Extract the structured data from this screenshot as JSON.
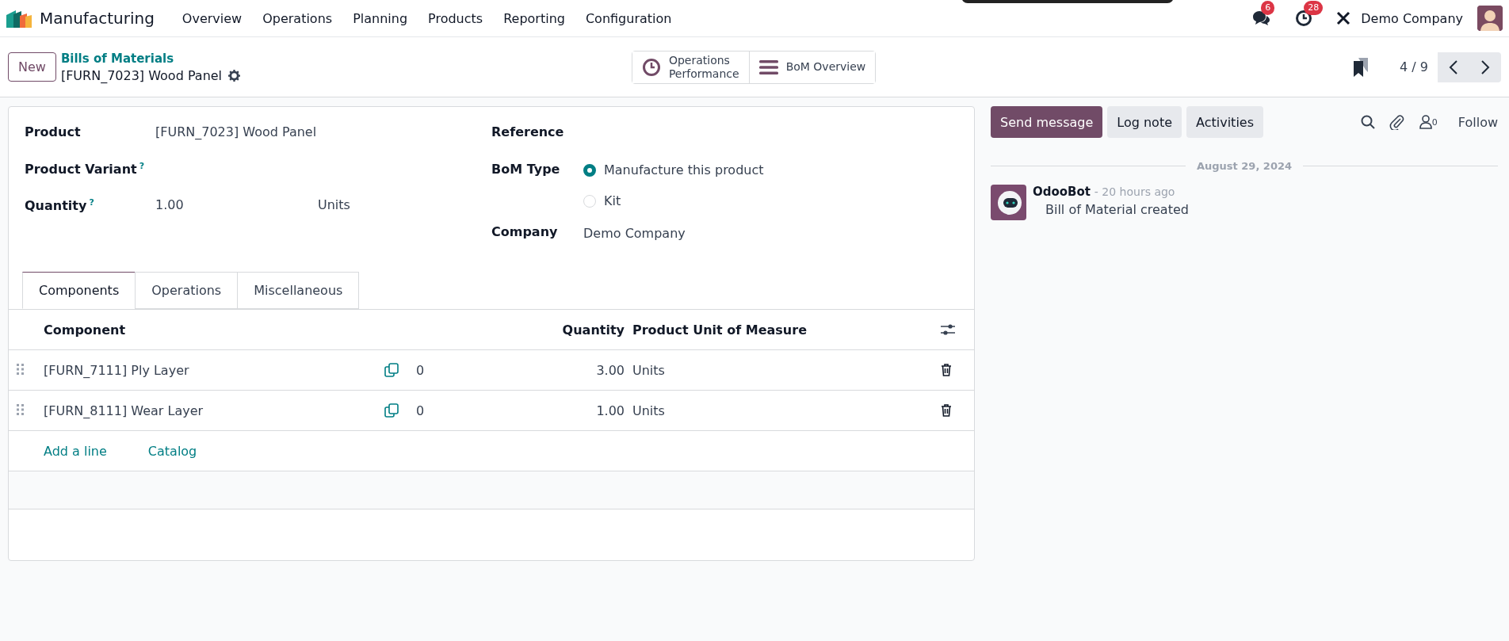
{
  "navbar": {
    "app_name": "Manufacturing",
    "menu": [
      "Overview",
      "Operations",
      "Planning",
      "Products",
      "Reporting",
      "Configuration"
    ],
    "notifications": [
      {
        "kind": "messages",
        "count": "6"
      },
      {
        "kind": "activities",
        "count": "28"
      }
    ],
    "company": "Demo Company"
  },
  "control_panel": {
    "new_button": "New",
    "breadcrumb": "Bills of Materials",
    "record_title": "[FURN_7023] Wood Panel",
    "smart_buttons": [
      {
        "kind": "clock",
        "lines": [
          "Operations",
          "Performance"
        ]
      },
      {
        "kind": "list",
        "lines": [
          "BoM Overview"
        ]
      }
    ],
    "pager": "4 / 9"
  },
  "form": {
    "left_fields": [
      {
        "label": "Product",
        "value": "[FURN_7023] Wood Panel"
      },
      {
        "label": "Product Variant",
        "help": "?"
      },
      {
        "label": "Quantity",
        "help": "?",
        "value": "1.00",
        "unit": "Units"
      }
    ],
    "reference_label": "Reference",
    "bom_type_label": "BoM Type",
    "bom_type_options": [
      {
        "label": "Manufacture this product",
        "selected": true
      },
      {
        "label": "Kit",
        "selected": false
      }
    ],
    "company_label": "Company",
    "company": "Demo Company"
  },
  "tabs": [
    {
      "label": "Components",
      "selected": true
    },
    {
      "label": "Operations",
      "selected": false
    },
    {
      "label": "Miscellaneous",
      "selected": false
    }
  ],
  "components": {
    "columns": [
      "Component",
      "Quantity",
      "Product Unit of Measure"
    ],
    "rows": [
      {
        "component": "[FURN_7111] Ply Layer",
        "count": "0",
        "quantity": "3.00",
        "uom": "Units"
      },
      {
        "component": "[FURN_8111] Wear Layer",
        "count": "0",
        "quantity": "1.00",
        "uom": "Units"
      }
    ],
    "add_line": "Add a line",
    "catalog": "Catalog"
  },
  "chatter": {
    "buttons": [
      {
        "label": "Send message",
        "kind": "primary"
      },
      {
        "label": "Log note",
        "kind": "secondary"
      },
      {
        "label": "Activities",
        "kind": "secondary"
      }
    ],
    "followers_count": "0",
    "follow": "Follow",
    "date": "August 29, 2024",
    "messages": [
      {
        "author": "OdooBot",
        "time": "- 20 hours ago",
        "body": "Bill of Material created"
      }
    ]
  }
}
